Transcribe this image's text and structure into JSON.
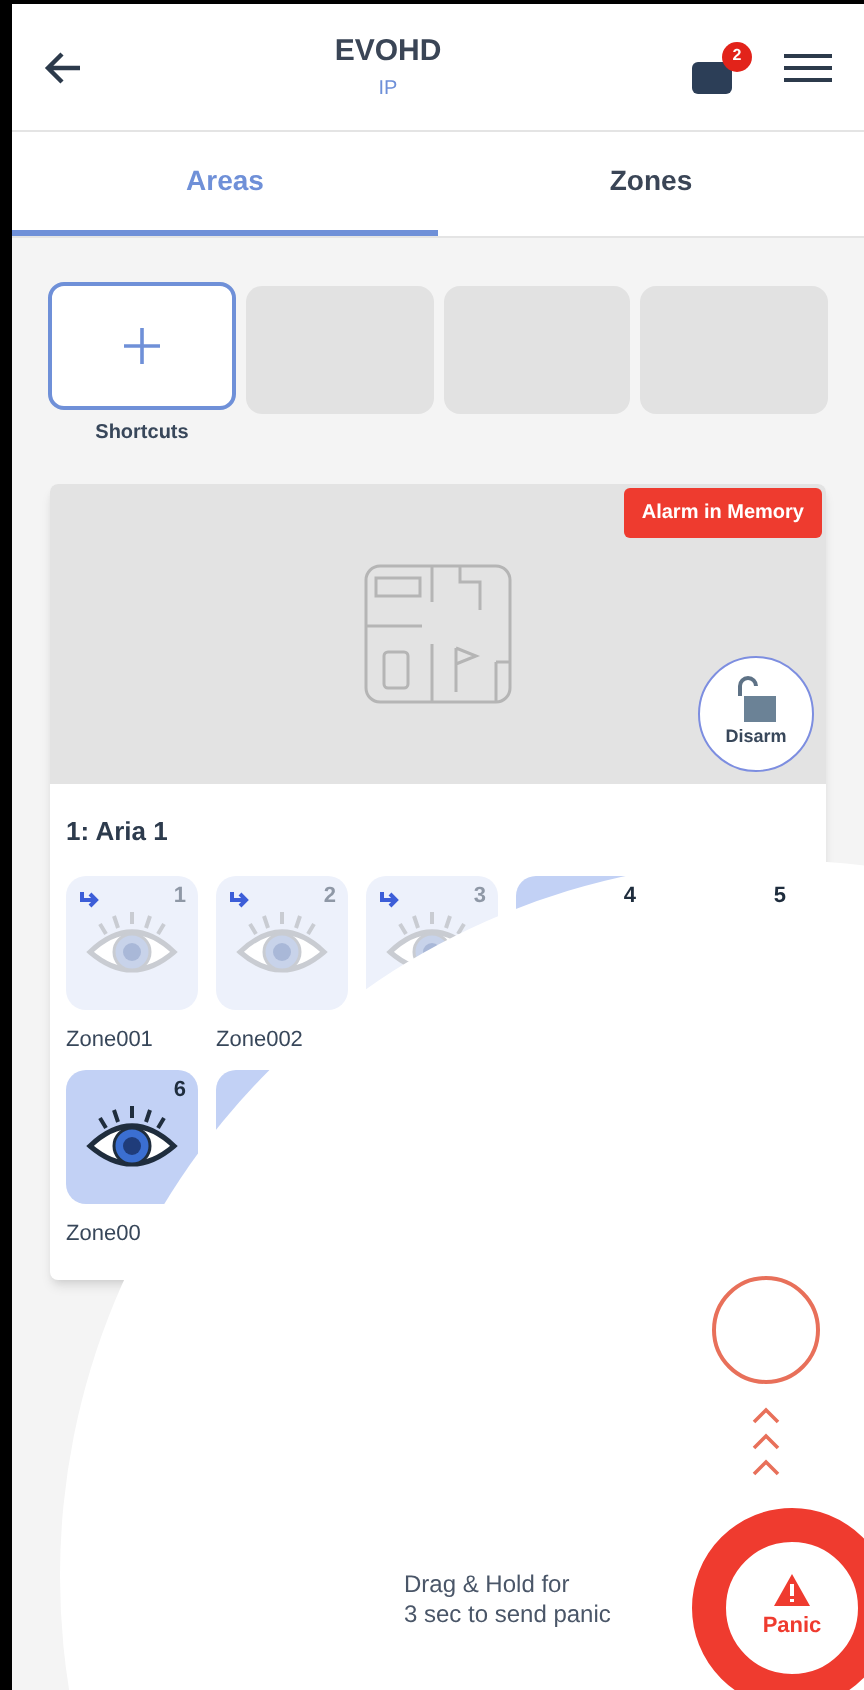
{
  "header": {
    "title": "EVOHD",
    "subtitle": "IP",
    "notification_count": "2"
  },
  "tabs": [
    {
      "label": "Areas",
      "selected": true
    },
    {
      "label": "Zones",
      "selected": false
    }
  ],
  "shortcuts": {
    "label": "Shortcuts"
  },
  "area": {
    "badge": "Alarm in Memory",
    "action": "Disarm",
    "title": "1: Aria 1",
    "zones": [
      {
        "number": "1",
        "label": "Zone001",
        "bypassed": true,
        "active": false
      },
      {
        "number": "2",
        "label": "Zone002",
        "bypassed": true,
        "active": false
      },
      {
        "number": "3",
        "bypassed": true,
        "active": false
      },
      {
        "number": "4",
        "bypassed": false,
        "active": true
      },
      {
        "number": "5",
        "bypassed": false,
        "active": true
      },
      {
        "number": "6",
        "label": "Zone00",
        "bypassed": false,
        "active": true
      },
      {
        "bypassed": false,
        "active": true
      }
    ]
  },
  "panic": {
    "hint": "Drag & Hold for\n3 sec to send panic",
    "label": "Panic"
  }
}
